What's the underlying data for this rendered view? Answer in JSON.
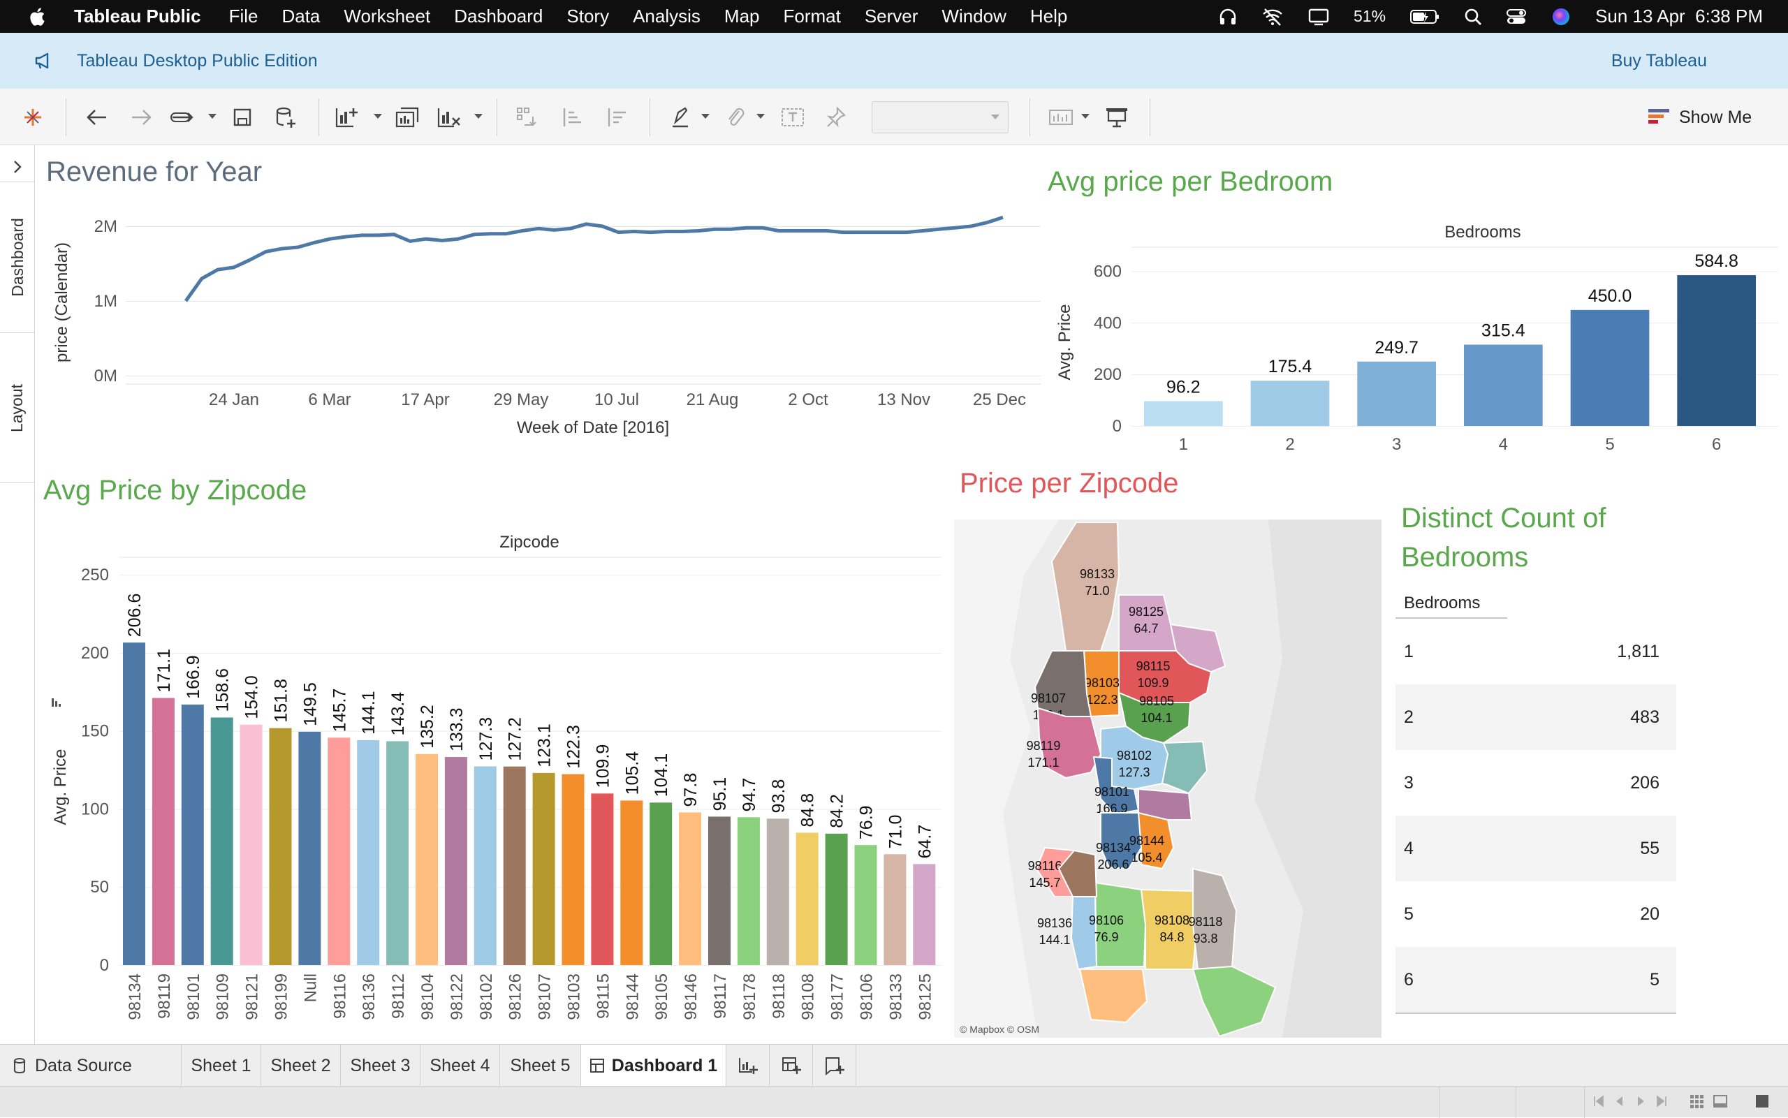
{
  "menubar": {
    "app_name": "Tableau Public",
    "items": [
      "File",
      "Data",
      "Worksheet",
      "Dashboard",
      "Story",
      "Analysis",
      "Map",
      "Format",
      "Server",
      "Window",
      "Help"
    ],
    "battery": "51%",
    "datetime": "Sun 13 Apr  6:38 PM"
  },
  "banner": {
    "text": "Tableau Desktop Public Edition",
    "buy": "Buy Tableau"
  },
  "toolbar": {
    "show_me": "Show Me",
    "icons": [
      "tableau-logo-icon",
      "undo-icon",
      "redo-icon",
      "replay-icon",
      "save-icon",
      "new-data-source-icon",
      "new-worksheet-icon",
      "duplicate-sheet-icon",
      "clear-sheet-icon",
      "swap-icon",
      "sort-ascending-icon",
      "sort-descending-icon",
      "highlight-icon",
      "annotate-icon",
      "labels-icon",
      "pin-icon",
      "fit-dropdown",
      "view-cards-icon",
      "presentation-icon"
    ]
  },
  "rail": {
    "tab_dashboard": "Dashboard",
    "tab_layout": "Layout"
  },
  "dashboard": {
    "revenue_title": "Revenue for Year",
    "bedroom_title": "Avg price per Bedroom",
    "zipcode_title": "Avg Price by Zipcode",
    "map_title": "Price per Zipcode",
    "count_title_line1": "Distinct Count of",
    "count_title_line2": "Bedrooms"
  },
  "chart_data": [
    {
      "type": "line",
      "title": "Revenue for Year",
      "xlabel": "Week of Date [2016]",
      "ylabel": "price (Calendar)",
      "x_ticks": [
        "24 Jan",
        "6 Mar",
        "17 Apr",
        "29 May",
        "10 Jul",
        "21 Aug",
        "2 Oct",
        "13 Nov",
        "25 Dec"
      ],
      "y_ticks": [
        "0M",
        "1M",
        "2M"
      ],
      "ylim": [
        0,
        2150000
      ],
      "x": [
        1,
        2,
        3,
        4,
        5,
        6,
        7,
        8,
        9,
        10,
        11,
        12,
        13,
        14,
        15,
        16,
        17,
        18,
        19,
        20,
        21,
        22,
        23,
        24,
        25,
        26,
        27,
        28,
        29,
        30,
        31,
        32,
        33,
        34,
        35,
        36,
        37,
        38,
        39,
        40,
        41,
        42,
        43,
        44,
        45,
        46,
        47,
        48,
        49,
        50,
        51,
        52
      ],
      "series": [
        {
          "values": [
            1000000,
            1300000,
            1420000,
            1450000,
            1550000,
            1660000,
            1700000,
            1720000,
            1780000,
            1830000,
            1860000,
            1880000,
            1880000,
            1890000,
            1800000,
            1830000,
            1810000,
            1830000,
            1890000,
            1900000,
            1900000,
            1940000,
            1970000,
            1950000,
            1970000,
            2030000,
            2000000,
            1920000,
            1930000,
            1920000,
            1930000,
            1930000,
            1940000,
            1960000,
            1960000,
            1980000,
            1980000,
            1940000,
            1940000,
            1940000,
            1940000,
            1920000,
            1920000,
            1920000,
            1920000,
            1920000,
            1940000,
            1960000,
            1980000,
            2000000,
            2050000,
            2120000
          ]
        }
      ]
    },
    {
      "type": "bar",
      "title": "Avg price per Bedroom",
      "header": "Bedrooms",
      "ylabel": "Avg. Price",
      "categories": [
        "1",
        "2",
        "3",
        "4",
        "5",
        "6"
      ],
      "values": [
        96.2,
        175.4,
        249.7,
        315.4,
        450.0,
        584.8
      ],
      "labels": [
        "96.2",
        "175.4",
        "249.7",
        "315.4",
        "450.0",
        "584.8"
      ],
      "y_ticks": [
        "0",
        "200",
        "400",
        "600"
      ],
      "ylim": [
        0,
        650
      ],
      "colors": [
        "#b9ddf1",
        "#9fcae6",
        "#7eafd6",
        "#6699c9",
        "#4a7db3",
        "#2a5783"
      ]
    },
    {
      "type": "bar",
      "title": "Avg Price by Zipcode",
      "header": "Zipcode",
      "ylabel": "Avg. Price",
      "categories": [
        "98134",
        "98119",
        "98101",
        "98109",
        "98121",
        "98199",
        "Null",
        "98116",
        "98136",
        "98112",
        "98104",
        "98122",
        "98102",
        "98126",
        "98107",
        "98103",
        "98115",
        "98144",
        "98105",
        "98146",
        "98117",
        "98178",
        "98118",
        "98108",
        "98177",
        "98106",
        "98133",
        "98125"
      ],
      "values": [
        206.6,
        171.1,
        166.9,
        158.6,
        154.0,
        151.8,
        149.5,
        145.7,
        144.1,
        143.4,
        135.2,
        133.3,
        127.3,
        127.2,
        123.1,
        122.3,
        109.9,
        105.4,
        104.1,
        97.8,
        95.1,
        94.7,
        93.8,
        84.8,
        84.2,
        76.9,
        71.0,
        64.7
      ],
      "labels": [
        "206.6",
        "171.1",
        "166.9",
        "158.6",
        "154.0",
        "151.8",
        "149.5",
        "145.7",
        "144.1",
        "143.4",
        "135.2",
        "133.3",
        "127.3",
        "127.2",
        "123.1",
        "122.3",
        "109.9",
        "105.4",
        "104.1",
        "97.8",
        "95.1",
        "94.7",
        "93.8",
        "84.8",
        "84.2",
        "76.9",
        "71.0",
        "64.7"
      ],
      "y_ticks": [
        "0",
        "50",
        "100",
        "150",
        "200",
        "250"
      ],
      "ylim": [
        0,
        255
      ],
      "colors": [
        "#4e79a7",
        "#d37295",
        "#4e79a7",
        "#499894",
        "#fabfd2",
        "#b6992d",
        "#4e79a7",
        "#ff9d9a",
        "#a0cbe8",
        "#86bcb6",
        "#ffbe7d",
        "#b07aa1",
        "#9fcae6",
        "#9d7660",
        "#b6992d",
        "#f28e2b",
        "#e15759",
        "#f28e2b",
        "#59a14f",
        "#ffbe7d",
        "#79706e",
        "#8cd17d",
        "#bab0ac",
        "#f1ce63",
        "#59a14f",
        "#8cd17d",
        "#d7b5a6",
        "#d4a6c8"
      ]
    },
    {
      "type": "table",
      "title": "Distinct Count of Bedrooms",
      "header": "Bedrooms",
      "rows": [
        {
          "bedrooms": "1",
          "count": "1,811"
        },
        {
          "bedrooms": "2",
          "count": "483"
        },
        {
          "bedrooms": "3",
          "count": "206"
        },
        {
          "bedrooms": "4",
          "count": "55"
        },
        {
          "bedrooms": "5",
          "count": "20"
        },
        {
          "bedrooms": "6",
          "count": "5"
        }
      ]
    }
  ],
  "map": {
    "attribution": "© Mapbox © OSM",
    "regions": [
      {
        "zip": "98133",
        "value": "71.0",
        "color": "#d7b5a6"
      },
      {
        "zip": "98125",
        "value": "64.7",
        "color": "#d4a6c8"
      },
      {
        "zip": "98115",
        "value": "109.9",
        "color": "#e15759"
      },
      {
        "zip": "98103",
        "value": "122.3",
        "color": "#f28e2b"
      },
      {
        "zip": "98107",
        "value": "123.1",
        "color": "#79706e"
      },
      {
        "zip": "98105",
        "value": "104.1",
        "color": "#59a14f"
      },
      {
        "zip": "98119",
        "value": "171.1",
        "color": "#d37295"
      },
      {
        "zip": "98102",
        "value": "127.3",
        "color": "#a0cbe8"
      },
      {
        "zip": "98101",
        "value": "166.9",
        "color": "#4e79a7"
      },
      {
        "zip": "98116",
        "value": "145.7",
        "color": "#ff9d9a"
      },
      {
        "zip": "98134",
        "value": "206.6",
        "color": "#4e79a7"
      },
      {
        "zip": "98144",
        "value": "105.4",
        "color": "#f28e2b"
      },
      {
        "zip": "98136",
        "value": "144.1",
        "color": "#a0cbe8"
      },
      {
        "zip": "98106",
        "value": "76.9",
        "color": "#8cd17d"
      },
      {
        "zip": "98108",
        "value": "84.8",
        "color": "#f1ce63"
      },
      {
        "zip": "98118",
        "value": "93.8",
        "color": "#bab0ac"
      }
    ]
  },
  "tabs": {
    "data_source": "Data Source",
    "sheets": [
      "Sheet 1",
      "Sheet 2",
      "Sheet 3",
      "Sheet 4",
      "Sheet 5"
    ],
    "active": "Dashboard 1"
  }
}
